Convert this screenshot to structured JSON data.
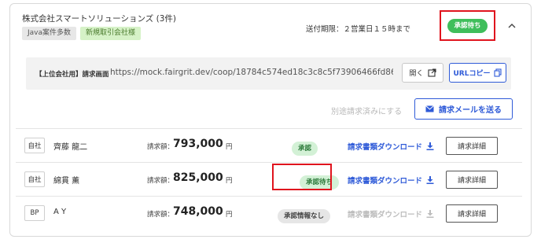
{
  "header": {
    "company": "株式会社スマートソリューションズ (3件)",
    "tags": [
      "Java案件多数",
      "新規取引会社様"
    ],
    "deadline": "送付期限：２営業日１５時まで",
    "status": "承認待ち"
  },
  "url_panel": {
    "label": "【上位会社用】請求画面",
    "url": "https://mock.fairgrit.dev/coop/18784c574ed18c3c8c5f73906466fd86a29973c3a67…",
    "open_label": "開く",
    "copy_label": "URLコピー"
  },
  "actions": {
    "mark_separate": "別途請求済みにする",
    "send_email": "請求メールを送る"
  },
  "rows": [
    {
      "type": "自社",
      "name": "齊藤 龍二",
      "amount_label": "請求額：",
      "amount": "793,000",
      "yen": "円",
      "status": "承認",
      "download": "請求書類ダウンロード",
      "download_enabled": true,
      "detail": "請求詳細"
    },
    {
      "type": "自社",
      "name": "綿貫 薫",
      "amount_label": "請求額：",
      "amount": "825,000",
      "yen": "円",
      "status": "承認待ち",
      "download": "請求書類ダウンロード",
      "download_enabled": true,
      "detail": "請求詳細"
    },
    {
      "type": "BP",
      "name": "A Y",
      "amount_label": "請求額：",
      "amount": "748,000",
      "yen": "円",
      "status": "承認情報なし",
      "download": "請求書類ダウンロード",
      "download_enabled": false,
      "detail": "請求詳細"
    }
  ],
  "colors": {
    "accent": "#2f5bd8",
    "highlight": "#e0141e",
    "status_green": "#3fbe5b"
  }
}
